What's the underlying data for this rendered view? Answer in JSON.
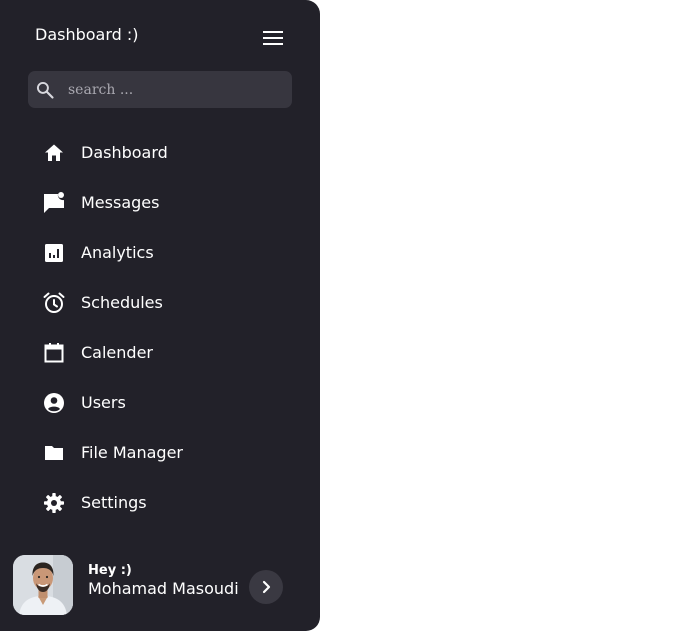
{
  "sidebar": {
    "title": "Dashboard :)",
    "menu_icon": "menu-icon",
    "search": {
      "placeholder": "search ...",
      "value": "",
      "icon": "search-icon"
    },
    "items": [
      {
        "label": "Dashboard",
        "icon": "home-icon"
      },
      {
        "label": "Messages",
        "icon": "messages-icon"
      },
      {
        "label": "Analytics",
        "icon": "analytics-icon"
      },
      {
        "label": "Schedules",
        "icon": "alarm-icon"
      },
      {
        "label": "Calender",
        "icon": "calendar-icon"
      },
      {
        "label": "Users",
        "icon": "user-icon"
      },
      {
        "label": "File Manager",
        "icon": "folder-icon"
      },
      {
        "label": "Settings",
        "icon": "gear-icon"
      }
    ],
    "profile": {
      "greeting": "Hey :)",
      "name": "Mohamad Masoudi",
      "action_icon": "chevron-right-icon"
    }
  },
  "colors": {
    "sidebar_bg": "#222129",
    "search_bg": "#37363f",
    "text": "#ffffff",
    "page_bg": "#ffffff"
  }
}
